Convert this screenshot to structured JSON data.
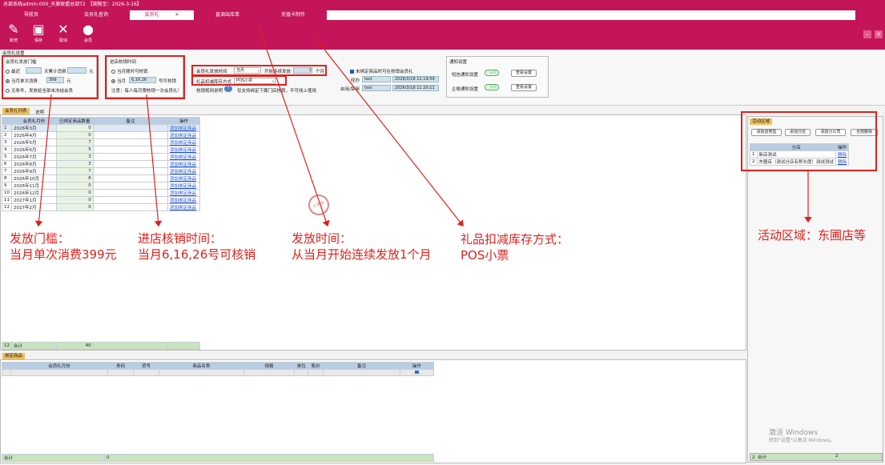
{
  "window": {
    "title": "总部系统admin:000_天兼联盟总部T2　【期限至：2026-3-16】",
    "tabs": [
      "导航页",
      "会员礼查询",
      "会员礼",
      "直调出库单",
      "充值卡制作"
    ],
    "active_tab": 2
  },
  "toolbar": {
    "buttons": [
      {
        "label": "新增",
        "icon": "edit-icon"
      },
      {
        "label": "保存",
        "icon": "save-icon"
      },
      {
        "label": "取消",
        "icon": "close-icon"
      },
      {
        "label": "会员",
        "icon": "user-icon"
      }
    ],
    "section_label": "会员礼设置"
  },
  "threshold": {
    "title": "会员礼发放门槛",
    "opt1_a": "最近",
    "opt1_b": "天累计消费",
    "opt1_unit": "元",
    "opt2_a": "当月单次消费",
    "opt2_value": "399",
    "opt2_unit": "元",
    "opt3": "无条件，发放给全部未冻结会员"
  },
  "redeem": {
    "title": "进店核销时间",
    "opt1": "当月随时可核销",
    "opt2_a": "当月",
    "opt2_value": "6,16,26",
    "opt2_b": "号可核销",
    "note": "注意：每人每月限核销一次会员礼！"
  },
  "issue": {
    "time_label": "会员礼发放时间",
    "time_value": "当月",
    "continuous_label": "开始连续发放",
    "months": "1",
    "months_unit": "个月",
    "stock_label": "礼品扣减库存方式",
    "stock_value": "POS小票",
    "rule_label": "核销规则说明",
    "rule_text": "仅支持绑定下属门店核销，不可线上使用"
  },
  "audit": {
    "checkbox_label": "未绑定商品时可在核销会员礼",
    "reviewer_label": "经办",
    "reviewer": "test",
    "reviewer_time": "2026/3/18 11:19:59",
    "enabler_label": "启用/禁用",
    "enabler": "test",
    "enabler_time": "2026/3/18 11:20:11"
  },
  "notify": {
    "title": "通知设置",
    "sms_label": "短信通知设置",
    "sms_state": "已启用",
    "sms_btn": "查看设置",
    "wechat_label": "企微通知设置",
    "wechat_state": "已启用",
    "wechat_btn": "查看设置"
  },
  "gift_list": {
    "tab1": "会员礼列表",
    "tab2": "说明",
    "headers": [
      "会员礼月份",
      "已绑定商品数量",
      "备注",
      "操作"
    ],
    "rows": [
      {
        "n": "1",
        "month": "2026年3月",
        "qty": "0",
        "op": "添加绑定商品"
      },
      {
        "n": "2",
        "month": "2026年4月",
        "qty": "0",
        "op": "添加绑定商品"
      },
      {
        "n": "3",
        "month": "2026年5月",
        "qty": "7",
        "op": "添加绑定商品"
      },
      {
        "n": "4",
        "month": "2026年6月",
        "qty": "5",
        "op": "添加绑定商品"
      },
      {
        "n": "5",
        "month": "2026年7月",
        "qty": "3",
        "op": "添加绑定商品"
      },
      {
        "n": "6",
        "month": "2026年8月",
        "qty": "3",
        "op": "添加绑定商品"
      },
      {
        "n": "7",
        "month": "2026年9月",
        "qty": "7",
        "op": "添加绑定商品"
      },
      {
        "n": "8",
        "month": "2026年10月",
        "qty": "6",
        "op": "添加绑定商品"
      },
      {
        "n": "9",
        "month": "2026年11月",
        "qty": "0",
        "op": "添加绑定商品"
      },
      {
        "n": "10",
        "month": "2026年12月",
        "qty": "0",
        "op": "添加绑定商品"
      },
      {
        "n": "11",
        "month": "2027年1月",
        "qty": "0",
        "op": "添加绑定商品"
      },
      {
        "n": "12",
        "month": "2027年2月",
        "qty": "0",
        "op": "添加绑定商品"
      }
    ],
    "footer_n": "12",
    "footer_label": "合计",
    "footer_total": "40"
  },
  "bound": {
    "tab": "绑定商品",
    "headers": [
      "会员礼月份",
      "条码",
      "货号",
      "商品名称",
      "规格",
      "单位",
      "售价",
      "备注",
      "操作"
    ],
    "footer_label": "合计",
    "footer_total": "0"
  },
  "region": {
    "title": "活动区域",
    "buttons": [
      "添加店类型",
      "添加分店",
      "添加分公司",
      "全部删除"
    ],
    "headers": [
      "分店",
      "操作"
    ],
    "rows": [
      {
        "n": "1",
        "name": "新店测试",
        "op": "删除"
      },
      {
        "n": "2",
        "name": "东圃店（测试分店名称长度）测试测试",
        "op": "删除"
      }
    ],
    "footer_n": "2",
    "footer_label": "合计",
    "footer_total": "2"
  },
  "stamp": "已审核",
  "watermark": {
    "line1": "激活 Windows",
    "line2": "转到\"设置\"以激活 Windows。"
  },
  "annotations": {
    "a1_l1": "发放门槛：",
    "a1_l2": "当月单次消费399元",
    "a2_l1": "进店核销时间：",
    "a2_l2": "当月6,16,26号可核销",
    "a3_l1": "发放时间：",
    "a3_l2": "从当月开始连续发放1个月",
    "a4_l1": "礼品扣减库存方式：",
    "a4_l2": "POS小票",
    "a5": "活动区域：东圃店等"
  }
}
